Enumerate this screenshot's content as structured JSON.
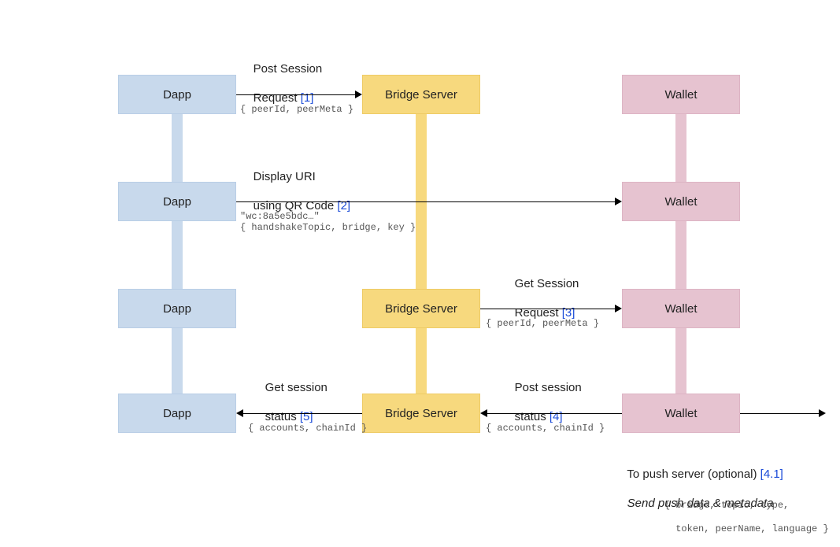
{
  "colors": {
    "dapp": "#c8d9ec",
    "bridge": "#f7d97e",
    "wallet": "#e6c3d0",
    "step_ref": "#1a4bd8"
  },
  "actors": {
    "dapp": "Dapp",
    "bridge": "Bridge Server",
    "wallet": "Wallet"
  },
  "rows": {
    "1": {
      "title_line1": "Post Session",
      "title_line2": "Request ",
      "step": "[1]",
      "payload": "{ peerId, peerMeta }"
    },
    "2": {
      "title_line1": "Display URI",
      "title_line2": "using QR Code ",
      "step": "[2]",
      "uri_example": "\"wc:8a5e5bdc…\"",
      "payload": "{ handshakeTopic, bridge, key }"
    },
    "3": {
      "title_line1": "Get Session",
      "title_line2": "Request ",
      "step": "[3]",
      "payload": "{ peerId, peerMeta }"
    },
    "4a": {
      "title_line1": "Post session",
      "title_line2": "status ",
      "step": "[4]",
      "payload": "{ accounts, chainId }"
    },
    "4b": {
      "title_line1": "Get session",
      "title_line2": "status ",
      "step": "[5]",
      "payload": "{ accounts, chainId }"
    },
    "push": {
      "title": "To push server (optional) ",
      "step": "[4.1]",
      "subtitle": "Send push data & metadata",
      "payload_line1": "{ bridge, topic, type,",
      "payload_line2": "  token, peerName, language }"
    }
  }
}
